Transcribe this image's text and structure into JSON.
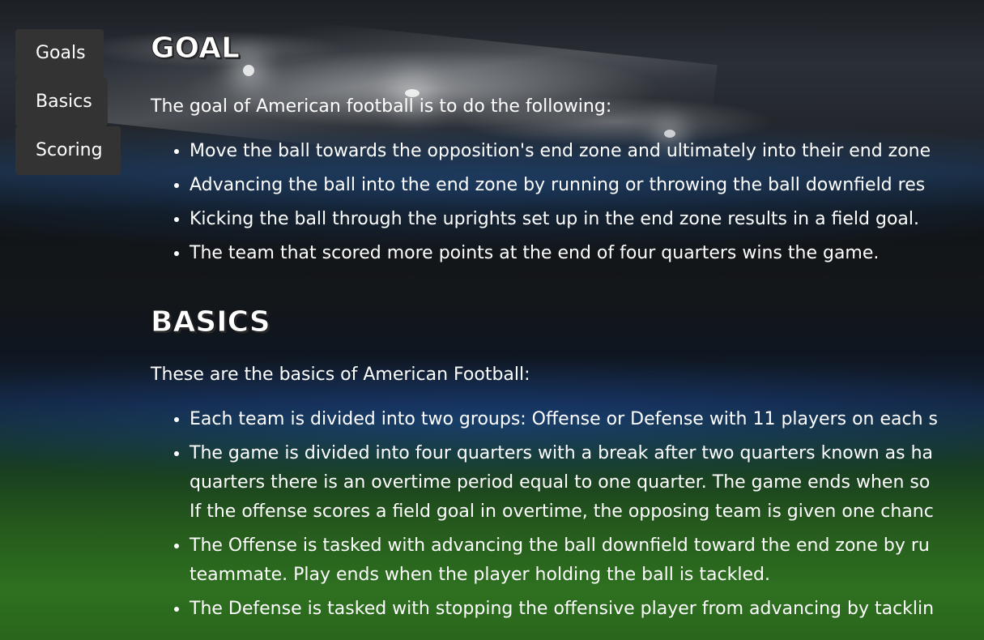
{
  "nav": {
    "items": [
      {
        "label": "Goals"
      },
      {
        "label": "Basics"
      },
      {
        "label": "Scoring"
      }
    ]
  },
  "sections": {
    "goal": {
      "title": "Goal",
      "intro": "The goal of American football is to do the following:",
      "items": [
        "Move the ball towards the opposition's end zone and ultimately into their end zone",
        "Advancing the ball into the end zone by running or throwing the ball downfield res",
        "Kicking the ball through the uprights set up in the end zone results in a field goal.",
        "The team that scored more points at the end of four quarters wins the game."
      ]
    },
    "basics": {
      "title": "Basics",
      "intro": "These are the basics of American Football:",
      "items": [
        {
          "lines": [
            "Each team is divided into two groups: Offense or Defense with 11 players on each s"
          ]
        },
        {
          "lines": [
            "The game is divided into four quarters with a break after two quarters known as ha",
            "quarters there is an overtime period equal to one quarter. The game ends when so",
            "If the offense scores a field goal in overtime, the opposing team is given one chanc"
          ]
        },
        {
          "lines": [
            "The Offense is tasked with advancing the ball downfield toward the end zone by ru",
            "teammate. Play ends when the player holding the ball is tackled."
          ]
        },
        {
          "lines": [
            "The Defense is tasked with stopping the offensive player from advancing by tacklin"
          ]
        }
      ]
    }
  }
}
